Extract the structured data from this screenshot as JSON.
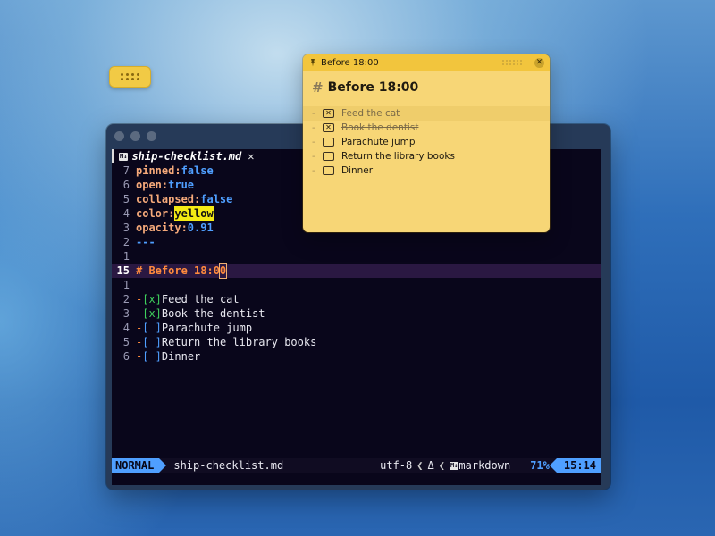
{
  "terminal": {
    "tab": {
      "icon": "markdown-icon",
      "icon_text": "M↓",
      "title": "ship-checklist.md",
      "close": "✕"
    },
    "frontmatter": [
      {
        "ln": "7",
        "key": "pinned:",
        "value": "false"
      },
      {
        "ln": "6",
        "key": "open:",
        "value": "true"
      },
      {
        "ln": "5",
        "key": "collapsed:",
        "value": "false"
      },
      {
        "ln": "4",
        "key": "color:",
        "value": "yellow"
      },
      {
        "ln": "3",
        "key": "opacity:",
        "value": "0.91"
      },
      {
        "ln": "2",
        "key": "",
        "value": "---"
      },
      {
        "ln": "1",
        "key": "",
        "value": ""
      }
    ],
    "current_line": {
      "ln": "15",
      "text": "# Before 18:0",
      "cursor_char": "0"
    },
    "blank_after": {
      "ln": "1"
    },
    "tasks": [
      {
        "ln": "2",
        "box": "[x]",
        "done": true,
        "text": "Feed the cat"
      },
      {
        "ln": "3",
        "box": "[x]",
        "done": true,
        "text": "Book the dentist"
      },
      {
        "ln": "4",
        "box": "[ ]",
        "done": false,
        "text": "Parachute jump"
      },
      {
        "ln": "5",
        "box": "[ ]",
        "done": false,
        "text": "Return the library books"
      },
      {
        "ln": "6",
        "box": "[ ]",
        "done": false,
        "text": "Dinner"
      }
    ],
    "status": {
      "mode": "NORMAL",
      "filename": "ship-checklist.md",
      "encoding": "utf-8",
      "fileformat_icon": "Δ",
      "filetype_icon_text": "M↓",
      "filetype": "markdown",
      "percent": "71%",
      "position": "15:14"
    }
  },
  "sticky_note": {
    "window_title": "Before 18:00",
    "close": "✕",
    "heading_hash": "#",
    "heading": "Before 18:00",
    "items": [
      {
        "text": "Feed the cat",
        "checked": true
      },
      {
        "text": "Book the dentist",
        "checked": true
      },
      {
        "text": "Parachute jump",
        "checked": false
      },
      {
        "text": "Return the library books",
        "checked": false
      },
      {
        "text": "Dinner",
        "checked": false
      }
    ],
    "bullet": "-",
    "check_mark": "✕",
    "color": "#f7d676"
  },
  "colors": {
    "accent_blue": "#4f9fff",
    "heading_orange": "#ff8a3d",
    "done_green": "#3ecf5c",
    "highlight_yellow": "#f4ea14",
    "editor_bg": "#09061b"
  }
}
